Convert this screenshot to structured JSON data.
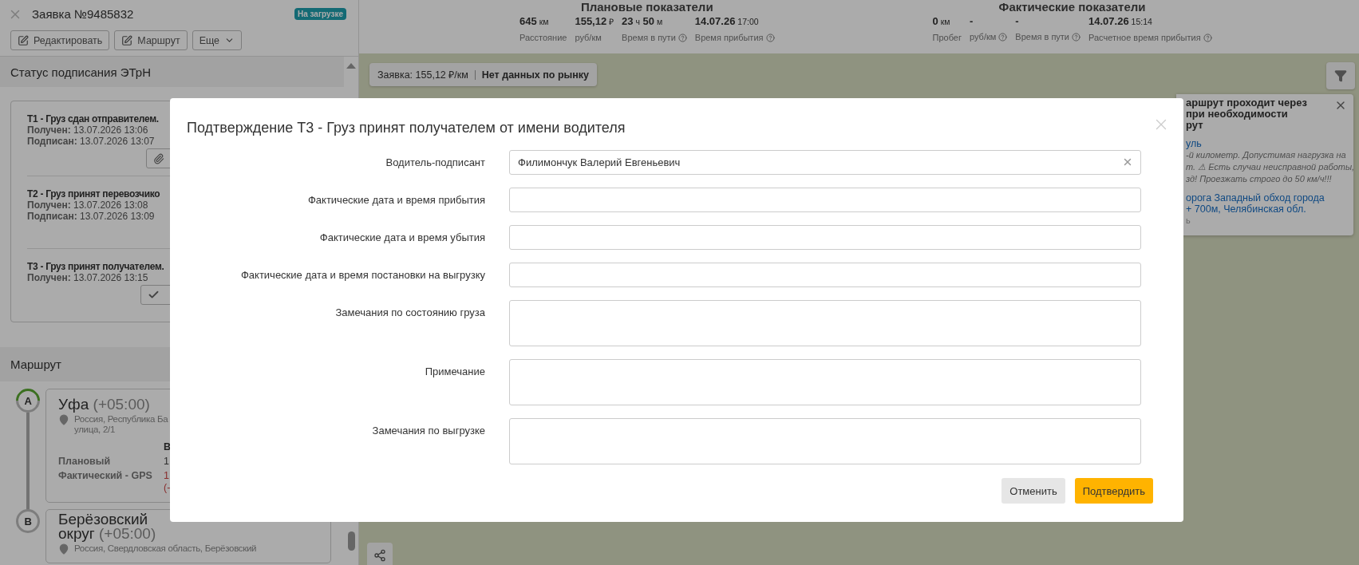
{
  "order": {
    "title": "Заявка №9485832",
    "status": "На загрузке"
  },
  "toolbar": [
    {
      "label": "Редактировать",
      "kind": "edit"
    },
    {
      "label": "Маршрут",
      "kind": "edit"
    },
    {
      "label": "Еще",
      "kind": "dropdown"
    }
  ],
  "etrn": {
    "title": "Статус подписания ЭТрН",
    "steps": [
      {
        "title": "T1 - Груз сдан отправителем.",
        "lines": [
          "**Получен:** 13.07.2026 13:06",
          "**Подписан:** 13.07.2026 13:07"
        ],
        "kind": "attach"
      },
      {
        "title": "T2 - Груз принят перевозчико",
        "lines": [
          "**Получен:** 13.07.2026 13:08",
          "**Подписан:** 13.07.2026 13:09"
        ]
      },
      {
        "title": "T3 - Груз принят получателем.",
        "lines": [
          "**Получен:** 13.07.2026 13:15"
        ],
        "kind": "confirm"
      }
    ]
  },
  "route": {
    "title": "Маршрут",
    "points": [
      {
        "letter": "A",
        "arrived": true,
        "name_lines": [
          "Уфа"
        ],
        "tz": "(+05:00)",
        "address_lines": [
          "Россия, Республика Ба",
          "улица, 2/1"
        ],
        "table_header": "В",
        "rows": [
          {
            "label": "Плановый",
            "value": "1",
            "late": false
          },
          {
            "label": "Фактический - GPS",
            "value": "1",
            "late": true,
            "note": "(-"
          }
        ]
      },
      {
        "letter": "B",
        "arrived": false,
        "name_lines": [
          "Берёзовский",
          "округ"
        ],
        "tz": "(+05:00)",
        "address_lines": [
          "Россия, Свердловская область, Берёзовский"
        ]
      }
    ]
  },
  "metrics": [
    {
      "title": "Плановые показатели",
      "items": [
        {
          "value": "645",
          "unit": "км",
          "label": "Расстояние",
          "info": false
        },
        {
          "value": "155,12",
          "unit": "₽",
          "label": "руб/км",
          "info": false
        },
        {
          "value": "23",
          "unit": "ч",
          "value2": "50",
          "unit2": "м",
          "label": "Время в пути",
          "info": true
        },
        {
          "value": "14.07.26",
          "unit": "17:00",
          "label": "Время прибытия",
          "info": true
        }
      ]
    },
    {
      "title": "Фактические показатели",
      "items": [
        {
          "value": "0",
          "unit": "км",
          "label": "Пробег",
          "info": false
        },
        {
          "value": "-",
          "label": "руб/км",
          "info": true
        },
        {
          "value": "-",
          "label": "Время в пути",
          "info": true
        },
        {
          "value": "14.07.26",
          "unit": "15:14",
          "label": "Расчетное время прибытия",
          "info": true
        }
      ]
    }
  ],
  "map": {
    "chip": {
      "rate": "Заявка: 155,12 ₽/км",
      "market": "Нет данных по рынку"
    },
    "notice": {
      "lines": [
        {
          "kind": "heading",
          "text": "аршрут проходит через"
        },
        {
          "kind": "heading",
          "text": "при необходимости"
        },
        {
          "kind": "heading",
          "text": "рут"
        },
        {
          "kind": "link",
          "text": "уль"
        },
        {
          "kind": "note",
          "text": "-й километр. Допустимая нагрузка на"
        },
        {
          "kind": "note",
          "text": "т. ⚠ Есть случаи неисправной работы,"
        },
        {
          "kind": "note",
          "text": "зд! Проезжать строго до 50 км/ч!!!"
        },
        {
          "kind": "link",
          "text": "орога Западный обход города"
        },
        {
          "kind": "link",
          "text": "+ 700м, Челябинская обл."
        },
        {
          "kind": "muted",
          "text": "ь"
        }
      ]
    }
  },
  "modal": {
    "title": "Подтверждение Т3 - Груз принят получателем от имени водителя",
    "fields": [
      {
        "label": "Водитель-подписант",
        "kind": "select",
        "value": "Филимончук Валерий Евгеньевич"
      },
      {
        "label": "Фактические дата и время прибытия",
        "kind": "input"
      },
      {
        "label": "Фактические дата и время убытия",
        "kind": "input"
      },
      {
        "label": "Фактические дата и время постановки на выгрузку",
        "kind": "input"
      },
      {
        "label": "Замечания по состоянию груза",
        "kind": "textarea"
      },
      {
        "label": "Примечание",
        "kind": "textarea"
      },
      {
        "label": "Замечания по выгрузке",
        "kind": "textarea"
      }
    ],
    "buttons": [
      {
        "label": "Отменить",
        "kind": "secondary"
      },
      {
        "label": "Подтвердить",
        "kind": "primary"
      }
    ]
  }
}
